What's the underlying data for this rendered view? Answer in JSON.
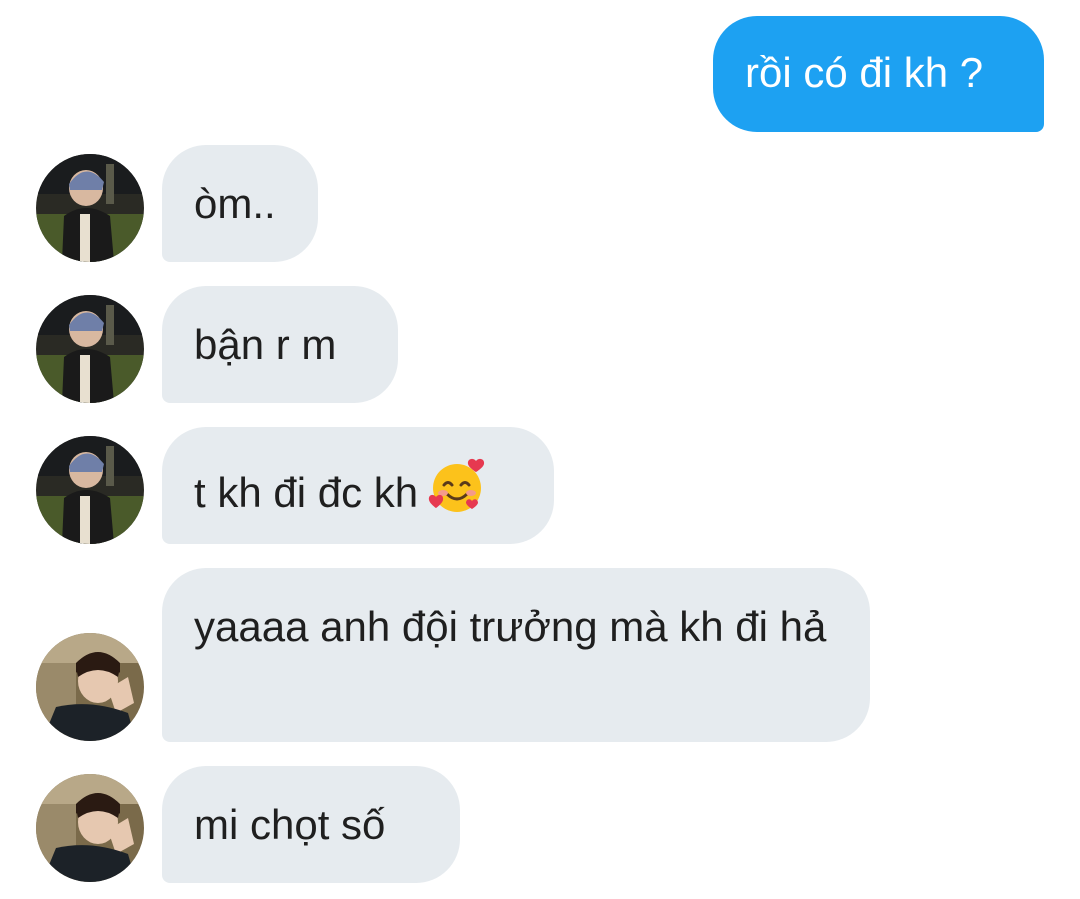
{
  "messages": [
    {
      "id": "m1",
      "direction": "outgoing",
      "text": "rồi có đi kh ?"
    },
    {
      "id": "m2",
      "direction": "incoming",
      "sender_avatar": "avatar-a",
      "text": "òm.."
    },
    {
      "id": "m3",
      "direction": "incoming",
      "sender_avatar": "avatar-a",
      "text": "bận r m"
    },
    {
      "id": "m4",
      "direction": "incoming",
      "sender_avatar": "avatar-a",
      "text": "t kh đi đc kh",
      "emoji": "smiling-face-with-hearts-icon"
    },
    {
      "id": "m5",
      "direction": "incoming",
      "sender_avatar": "avatar-b",
      "text": "yaaaa anh đội trưởng mà kh đi hả"
    },
    {
      "id": "m6",
      "direction": "incoming",
      "sender_avatar": "avatar-b",
      "text": "mi chọt số"
    }
  ],
  "colors": {
    "outgoing_bubble": "#1da1f2",
    "incoming_bubble": "#e6ebef",
    "outgoing_text": "#ffffff",
    "incoming_text": "#1f1f1f"
  }
}
